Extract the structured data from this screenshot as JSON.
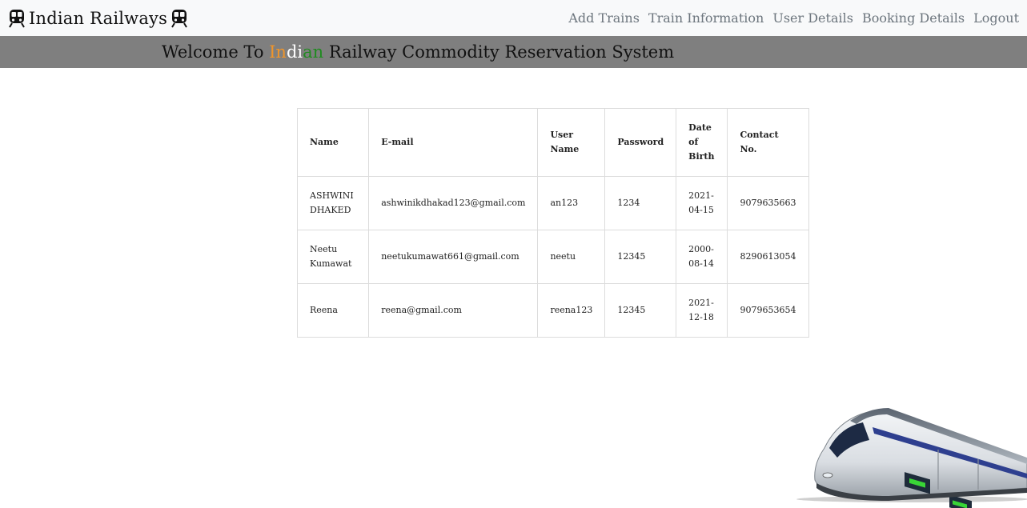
{
  "navbar": {
    "brand": "Indian Railways",
    "links": [
      "Add Trains",
      "Train Information",
      "User Details",
      "Booking Details",
      "Logout"
    ],
    "brand_icon": "train-icon"
  },
  "banner": {
    "welcome": "Welcome To ",
    "indian_parts": [
      "In",
      "di",
      "an"
    ],
    "rest": " Railway Commodity Reservation System",
    "colors": {
      "saffron": "#f0952a",
      "white": "#ffffff",
      "green": "#1f8b1f",
      "background": "#7f7f7f"
    }
  },
  "table": {
    "headers": [
      "Name",
      "E-mail",
      "User Name",
      "Password",
      "Date of Birth",
      "Contact No."
    ],
    "rows": [
      [
        "ASHWINI DHAKED",
        "ashwinikdhakad123@gmail.com",
        "an123",
        "1234",
        "2021-04-15",
        "9079635663"
      ],
      [
        "Neetu Kumawat",
        "neetukumawat661@gmail.com",
        "neetu",
        "12345",
        "2000-08-14",
        "8290613054"
      ],
      [
        "Reena",
        "reena@gmail.com",
        "reena123",
        "12345",
        "2021-12-18",
        "9079653654"
      ]
    ]
  }
}
